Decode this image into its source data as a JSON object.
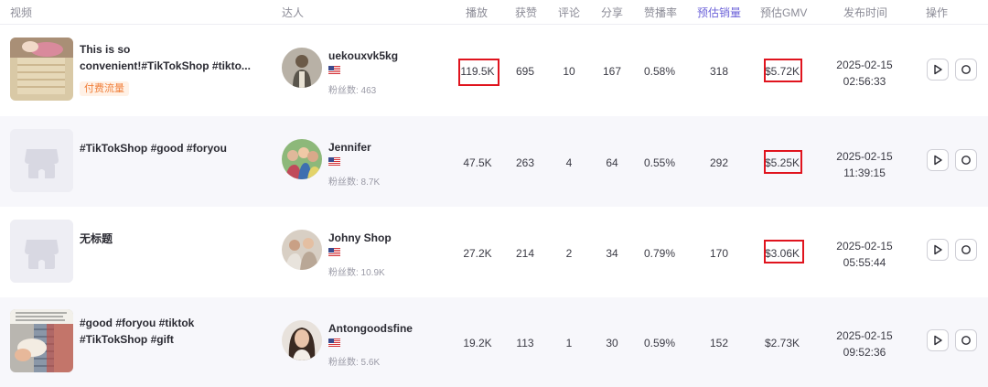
{
  "header": {
    "video": "视频",
    "creator": "达人",
    "plays": "播放",
    "likes": "获赞",
    "comments": "评论",
    "shares": "分享",
    "like_rate": "赞播率",
    "est_sales": "预估销量",
    "est_gmv": "预估GMV",
    "publish_time": "发布时间",
    "actions": "操作"
  },
  "rows": [
    {
      "title": "This is so convenient!#TikTokShop #tikto...",
      "tag": "付费流量",
      "creator": "uekouxvk5kg",
      "fans": "粉丝数: 463",
      "plays": "119.5K",
      "likes": "695",
      "comments": "10",
      "shares": "167",
      "like_rate": "0.58%",
      "sales": "318",
      "gmv": "$5.72K",
      "date": "2025-02-15",
      "time": "02:56:33"
    },
    {
      "title": "#TikTokShop #good #foryou",
      "tag": "",
      "creator": "Jennifer",
      "fans": "粉丝数: 8.7K",
      "plays": "47.5K",
      "likes": "263",
      "comments": "4",
      "shares": "64",
      "like_rate": "0.55%",
      "sales": "292",
      "gmv": "$5.25K",
      "date": "2025-02-15",
      "time": "11:39:15"
    },
    {
      "title": "无标题",
      "tag": "",
      "creator": "Johny Shop",
      "fans": "粉丝数: 10.9K",
      "plays": "27.2K",
      "likes": "214",
      "comments": "2",
      "shares": "34",
      "like_rate": "0.79%",
      "sales": "170",
      "gmv": "$3.06K",
      "date": "2025-02-15",
      "time": "05:55:44"
    },
    {
      "title": "#good #foryou #tiktok #TikTokShop #gift",
      "tag": "",
      "creator": "Antongoodsfine",
      "fans": "粉丝数: 5.6K",
      "plays": "19.2K",
      "likes": "113",
      "comments": "1",
      "shares": "30",
      "like_rate": "0.59%",
      "sales": "152",
      "gmv": "$2.73K",
      "date": "2025-02-15",
      "time": "09:52:36"
    }
  ],
  "icons": {
    "play": "play-icon",
    "detail": "circle-icon",
    "placeholder": "store-placeholder-icon",
    "flag": "us-flag-icon"
  },
  "colors": {
    "accent_header": "#6d63d9",
    "highlight_box": "#e0141e",
    "tag_text": "#f0803c",
    "tag_bg": "#fff1e6"
  }
}
